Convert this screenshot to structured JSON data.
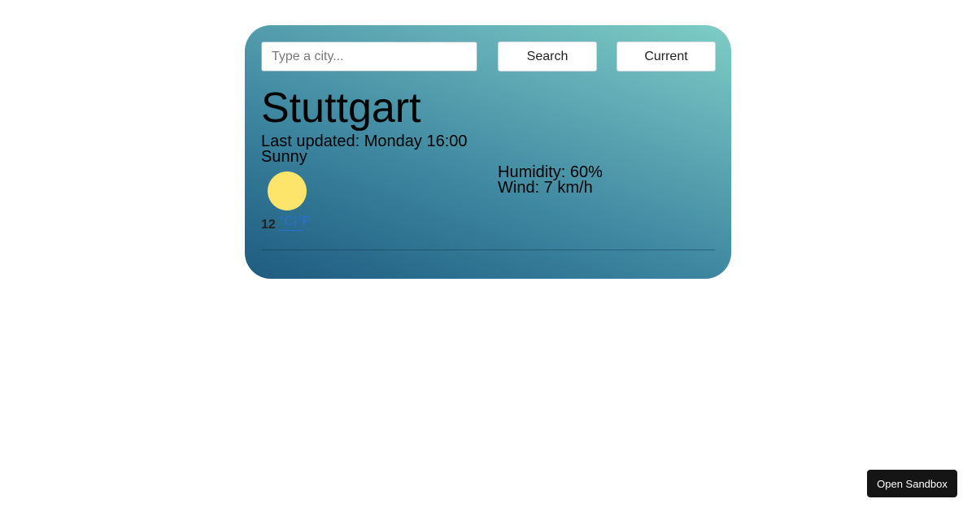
{
  "search": {
    "placeholder": "Type a city...",
    "value": "",
    "search_label": "Search",
    "current_label": "Current"
  },
  "weather": {
    "city": "Stuttgart",
    "last_updated": "Last updated: Monday 16:00",
    "description": "Sunny",
    "icon": "sun-icon",
    "temperature": "12",
    "unit_celsius": "°C",
    "unit_separator": "|",
    "unit_fahrenheit": "°F",
    "humidity": "Humidity: 60%",
    "wind": "Wind: 7 km/h"
  },
  "footer": {
    "open_sandbox_label": "Open Sandbox"
  },
  "colors": {
    "sun": "#fde46a",
    "link": "#2a6fd6",
    "card_gradient_top": "#7ecdc5",
    "card_gradient_bottom": "#1e5b80"
  }
}
